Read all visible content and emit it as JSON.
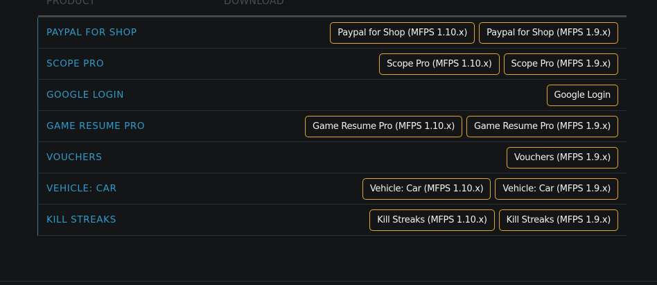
{
  "header": {
    "product": "PRODUCT",
    "download": "DOWNLOAD"
  },
  "rows": [
    {
      "name": "PAYPAL FOR SHOP",
      "buttons": [
        "Paypal for Shop (MFPS 1.10.x)",
        "Paypal for Shop (MFPS 1.9.x)"
      ]
    },
    {
      "name": "SCOPE PRO",
      "buttons": [
        "Scope Pro (MFPS 1.10.x)",
        "Scope Pro (MFPS 1.9.x)"
      ]
    },
    {
      "name": "GOOGLE LOGIN",
      "buttons": [
        "Google Login"
      ]
    },
    {
      "name": "GAME RESUME PRO",
      "buttons": [
        "Game Resume Pro (MFPS 1.10.x)",
        "Game Resume Pro (MFPS 1.9.x)"
      ]
    },
    {
      "name": "VOUCHERS",
      "buttons": [
        "Vouchers (MFPS 1.9.x)"
      ]
    },
    {
      "name": "VEHICLE: CAR",
      "buttons": [
        "Vehicle: Car (MFPS 1.10.x)",
        "Vehicle: Car (MFPS 1.9.x)"
      ]
    },
    {
      "name": "KILL STREAKS",
      "buttons": [
        "Kill Streaks (MFPS 1.10.x)",
        "Kill Streaks (MFPS 1.9.x)"
      ]
    }
  ],
  "colors": {
    "product_name": "#2d9ac9",
    "button_border": "#e0a82a",
    "background": "#141517"
  }
}
